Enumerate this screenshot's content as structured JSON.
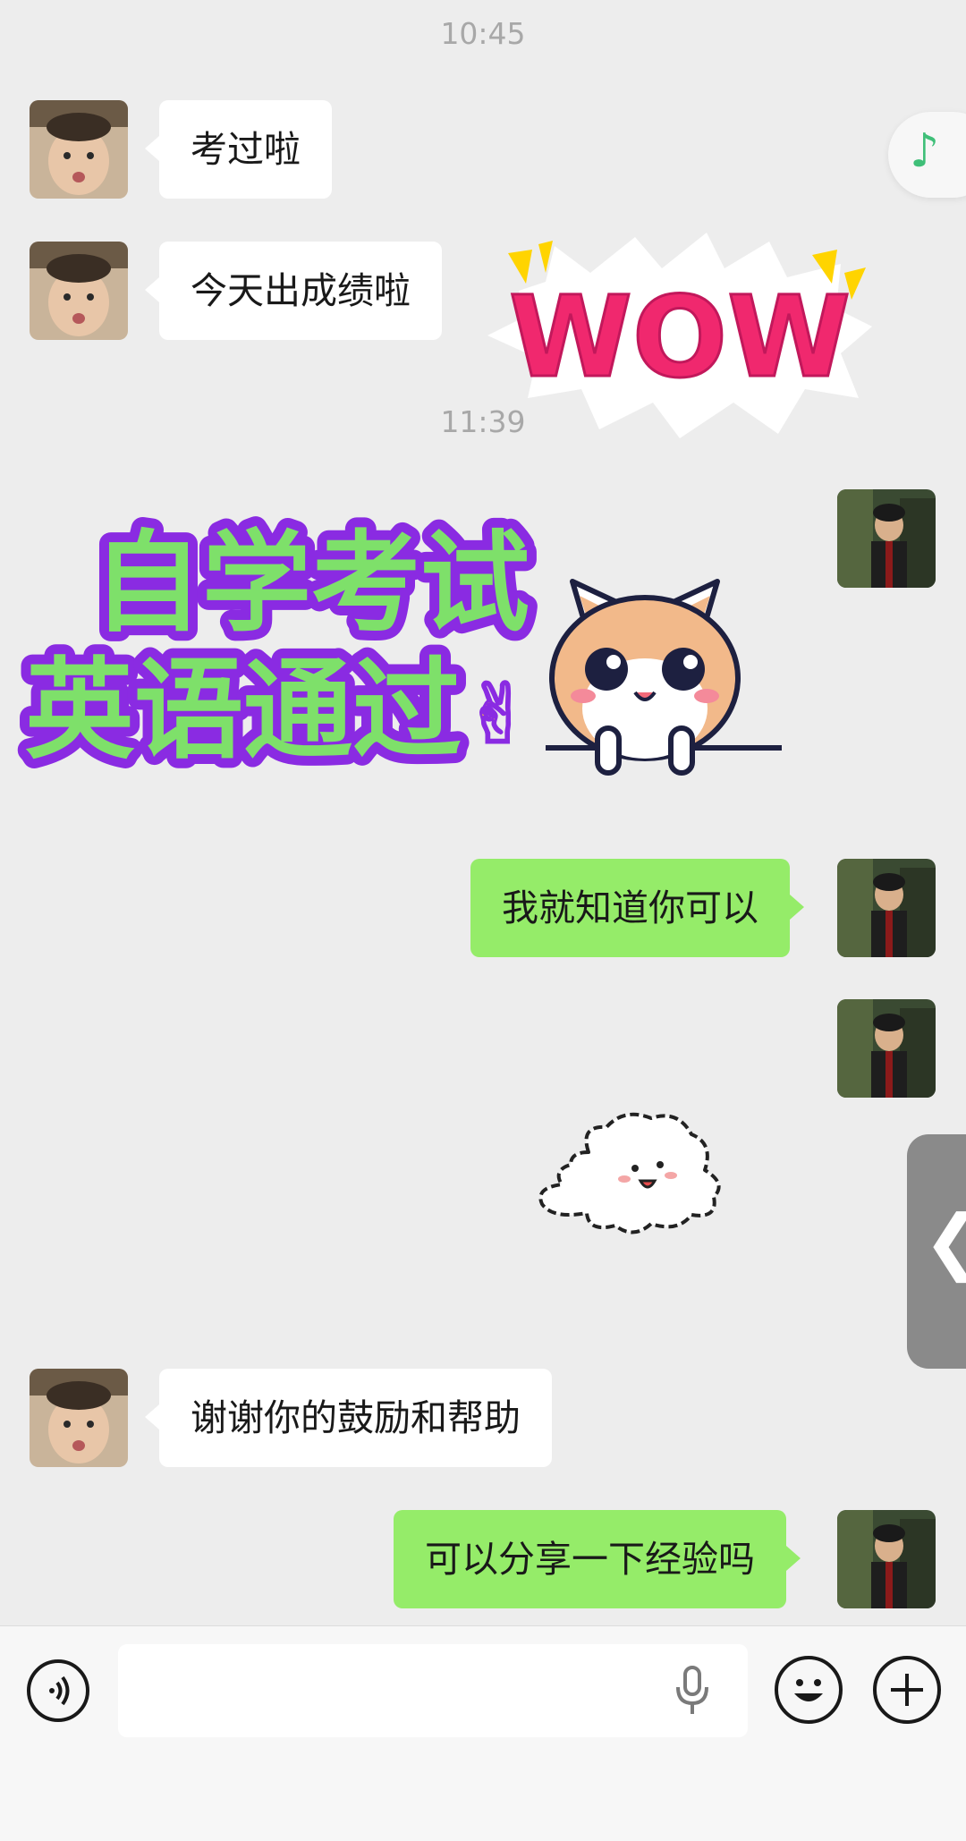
{
  "timestamps": [
    "10:45",
    "11:39"
  ],
  "messages": [
    {
      "side": "left",
      "text": "考过啦"
    },
    {
      "side": "left",
      "text": "今天出成绩啦"
    },
    {
      "side": "right",
      "text": "我就知道你可以"
    },
    {
      "side": "left",
      "text": "谢谢你的鼓励和帮助"
    },
    {
      "side": "right",
      "text": "可以分享一下经验吗"
    }
  ],
  "stickers": {
    "wow": {
      "text": "WOW",
      "color": "#f0286e"
    },
    "exam": {
      "line1": "自学考试",
      "line2": "英语通过",
      "emoji": "✌",
      "fill": "#7ee06a",
      "outline": "#8a2be2"
    }
  },
  "controls": {
    "music_icon": "♪",
    "side_handle_icon": "❮"
  },
  "icons": [
    "voice-icon",
    "microphone-icon",
    "emoji-icon",
    "plus-icon",
    "music-note-icon",
    "chevron-left-icon"
  ],
  "colors": {
    "background": "#ededed",
    "bubble_left": "#ffffff",
    "bubble_right": "#95ec69",
    "timestamp": "#a8a8a8"
  }
}
